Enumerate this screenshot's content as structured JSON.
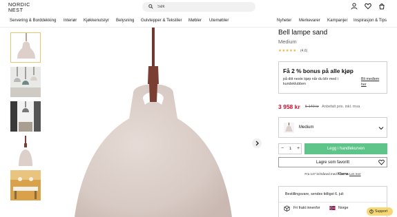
{
  "header": {
    "logo_line1": "NORDIC",
    "logo_line2": "NEST",
    "search_placeholder": "Søk",
    "icons": [
      "user-icon",
      "heart-icon",
      "cart-icon"
    ]
  },
  "nav": {
    "left": [
      "Servering & Borddekking",
      "Interiør",
      "Kjøkkenutstyr",
      "Belysning",
      "Gulvtepper & Tekstiler",
      "Møbler",
      "Utemøbler"
    ],
    "right": [
      "Nyheter",
      "Merkevarer",
      "Kampanjer",
      "Inspirasjon & Tips"
    ]
  },
  "gallery": {
    "thumbnails": [
      "lamp-front",
      "lamps-over-table",
      "lamp-dark-room",
      "lamp-closeup",
      "dining-room"
    ],
    "active_index": 0,
    "next_icon": "chevron-right-icon"
  },
  "product": {
    "title": "Bell lampe sand",
    "variant_name": "Medium",
    "stars": "★★★★★",
    "rating": "(4.6)"
  },
  "bonus": {
    "title": "Få 2 % bonus på alle kjøp",
    "text": "på ditt neste kjøp når du blir med i kundeklubben",
    "link": "Bli medlem her"
  },
  "price": {
    "current": "3 958 kr",
    "old": "5 140 kr",
    "note": "Anbefalt pris. inkl. mva"
  },
  "variant_select": {
    "selected": "Medium"
  },
  "purchase": {
    "qty": "1",
    "minus": "−",
    "plus": "+",
    "cart_label": "Legg i handlekurven",
    "fav_label": "Lagre som favoritt"
  },
  "klarna": {
    "prefix": "Fra 147 kr/måned med",
    "logo": "Klarna",
    "link": "Les mer"
  },
  "shipping": {
    "availability": "Bestillingsvare, sendes tidligst 6. juli",
    "free": "Fri frakt innenfor",
    "country": "Norge"
  },
  "support": {
    "label": "Support"
  },
  "colors": {
    "accent_green": "#5ec48a",
    "price_red": "#c8102e",
    "star_gold": "#e9b339",
    "thumb_active": "#e9c36b",
    "lamp_shade": "#ddd0ca",
    "cord_brown": "#7a3e33"
  }
}
